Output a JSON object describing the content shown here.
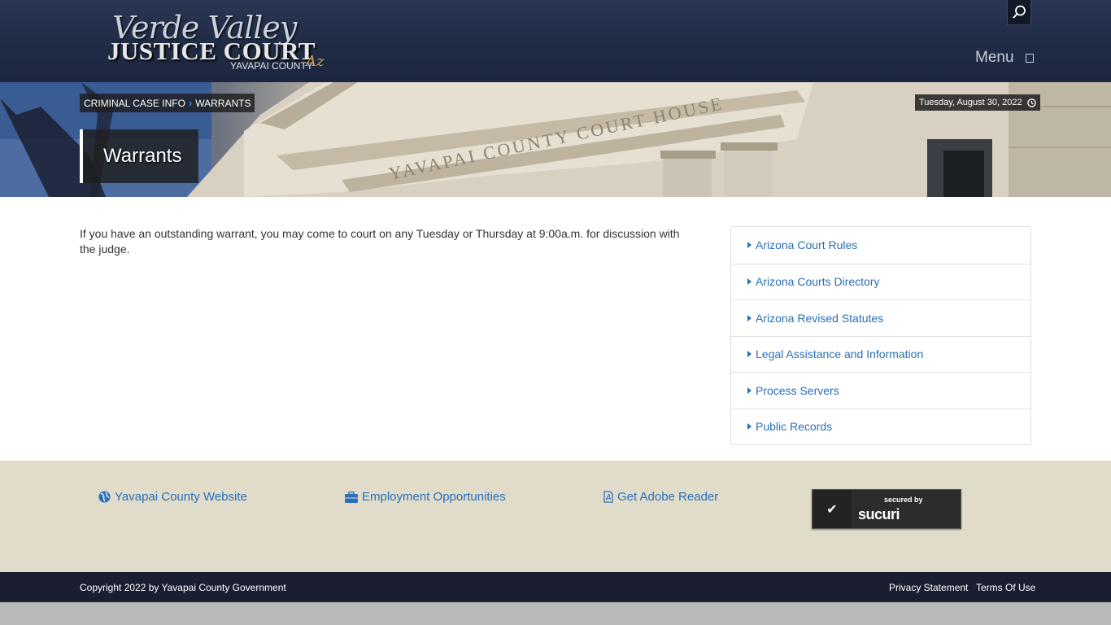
{
  "header": {
    "logo_line1": "Verde Valley",
    "logo_line2": "JUSTICE COURT",
    "logo_line3": "YAVAPAI COUNTY",
    "logo_line4": "Az",
    "menu_label": "Menu",
    "search_icon": "search-icon"
  },
  "breadcrumb": {
    "items": [
      "CRIMINAL CASE INFO",
      "WARRANTS"
    ],
    "separator": "›"
  },
  "date": "Tuesday, August 30, 2022",
  "page_title": "Warrants",
  "hero_engraving": "YAVAPAI COUNTY COURT HOUSE",
  "content": {
    "text": "If you have an outstanding warrant, you may come to court on any Tuesday or Thursday at 9:00a.m. for discussion with the judge."
  },
  "sidebar_links": [
    "Arizona Court Rules",
    "Arizona Courts Directory",
    "Arizona Revised Statutes",
    "Legal Assistance and Information",
    "Process Servers",
    "Public Records"
  ],
  "footer": {
    "links": [
      {
        "label": "Yavapai County Website",
        "icon": "globe-icon"
      },
      {
        "label": "Employment Opportunities",
        "icon": "briefcase-icon"
      },
      {
        "label": "Get Adobe Reader",
        "icon": "pdf-file-icon"
      }
    ],
    "sucuri": {
      "secured_by": "secured by",
      "brand": "sucuri"
    }
  },
  "bottom": {
    "copyright": "Copyright 2022 by Yavapai County Government",
    "privacy": "Privacy Statement",
    "terms": "Terms Of Use"
  },
  "colors": {
    "header_bg": "#1f2a44",
    "link": "#2a6fb8",
    "footer_bg": "#e1dcca",
    "bottom_bar": "#1b1d33"
  }
}
